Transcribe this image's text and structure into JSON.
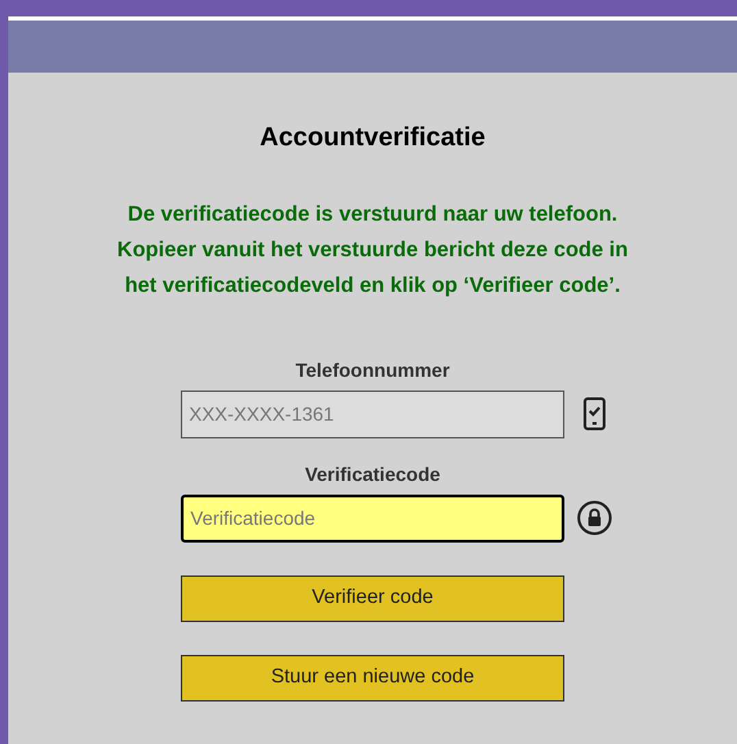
{
  "dialog": {
    "title": "Accountverificatie",
    "message": "De verificatiecode is verstuurd naar uw telefoon. Kopieer vanuit het verstuurde bericht deze code in het verificatiecodeveld en klik op ‘Verifieer code’."
  },
  "fields": [
    {
      "kind": "phone",
      "label": "Telefoonnummer",
      "value": "XXX-XXXX-1361",
      "disabled": true,
      "focused": false
    },
    {
      "kind": "code",
      "label": "Verificatiecode",
      "placeholder": "Verificatiecode",
      "disabled": false,
      "focused": true
    }
  ],
  "buttons": [
    "Verifieer code",
    "Stuur een nieuwe code"
  ]
}
